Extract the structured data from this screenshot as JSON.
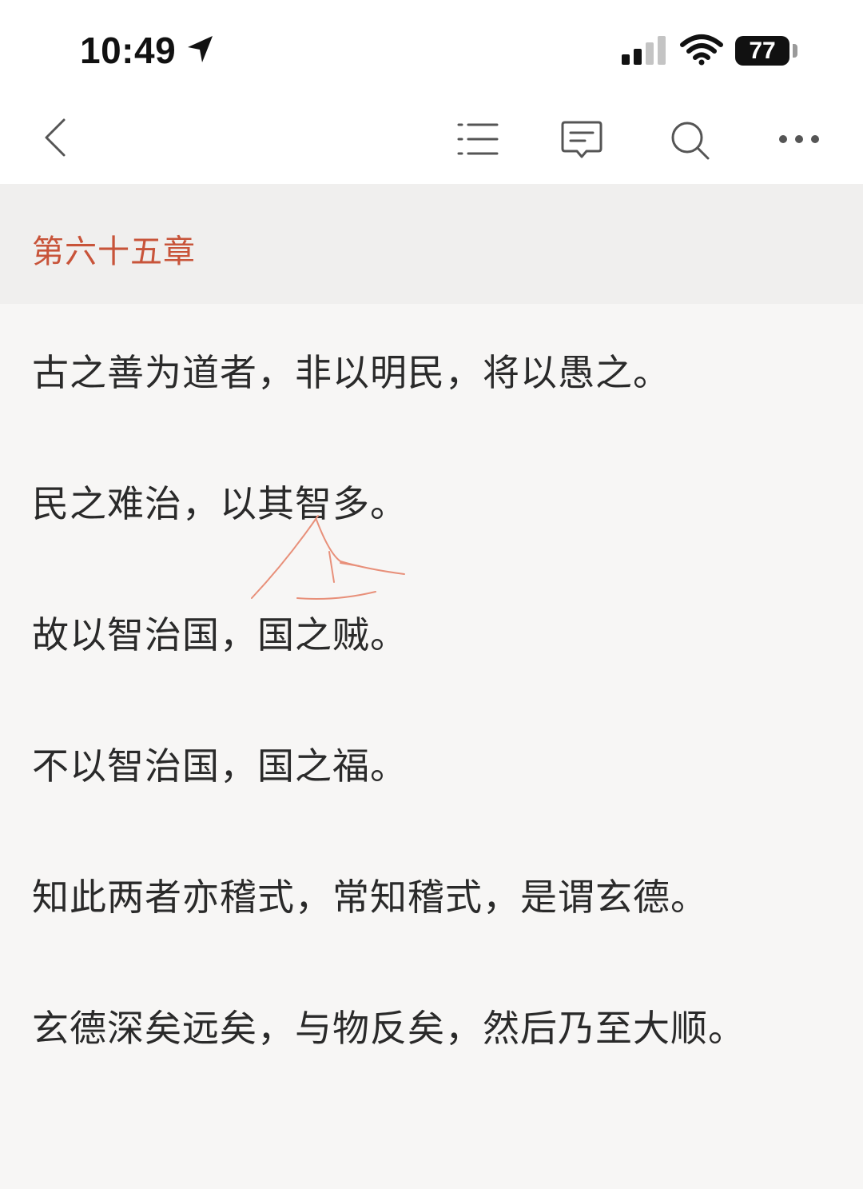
{
  "status_bar": {
    "time": "10:49",
    "battery": "77",
    "icons": [
      "location-arrow-icon",
      "cellular-signal-icon",
      "wifi-icon",
      "battery-icon"
    ]
  },
  "toolbar": {
    "icons": [
      "back-chevron-icon",
      "table-of-contents-icon",
      "comment-icon",
      "search-icon",
      "more-icon"
    ]
  },
  "chapter": {
    "title": "第六十五章",
    "title_color": "#c8543a"
  },
  "content": {
    "lines": [
      "古之善为道者，非以明民，将以愚之。",
      "民之难治，以其智多。",
      "故以智治国，国之贼。",
      "不以智治国，国之福。",
      "知此两者亦稽式，常知稽式，是谓玄德。",
      "玄德深矣远矣，与物反矣，然后乃至大顺。"
    ]
  },
  "annotation": {
    "type": "handwritten-doodle",
    "color": "#e8907a"
  }
}
